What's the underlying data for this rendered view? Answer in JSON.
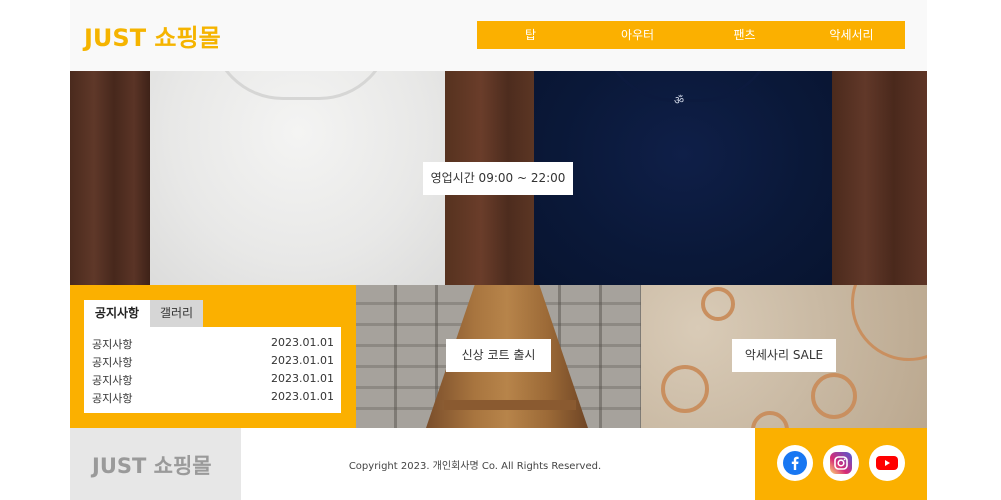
{
  "header": {
    "logo": "JUST 쇼핑몰",
    "nav": [
      "탑",
      "아우터",
      "팬츠",
      "악세서리"
    ]
  },
  "hero": {
    "hours": "영업시간 09:00 ~ 22:00"
  },
  "notice": {
    "tabs": [
      "공지사항",
      "갤러리"
    ],
    "items": [
      {
        "title": "공지사항",
        "date": "2023.01.01"
      },
      {
        "title": "공지사항",
        "date": "2023.01.01"
      },
      {
        "title": "공지사항",
        "date": "2023.01.01"
      },
      {
        "title": "공지사항",
        "date": "2023.01.01"
      }
    ]
  },
  "banners": {
    "coat": "신상 코트 출시",
    "accessory": "악세사리 SALE"
  },
  "footer": {
    "logo": "JUST 쇼핑몰",
    "copyright": "Copyright 2023. 개인회사명 Co. All Rights Reserved.",
    "sns": [
      "facebook-icon",
      "instagram-icon",
      "youtube-icon"
    ]
  },
  "colors": {
    "accent": "#fbb000",
    "logo": "#f5b400",
    "footer_logo": "#9a9a9a"
  }
}
